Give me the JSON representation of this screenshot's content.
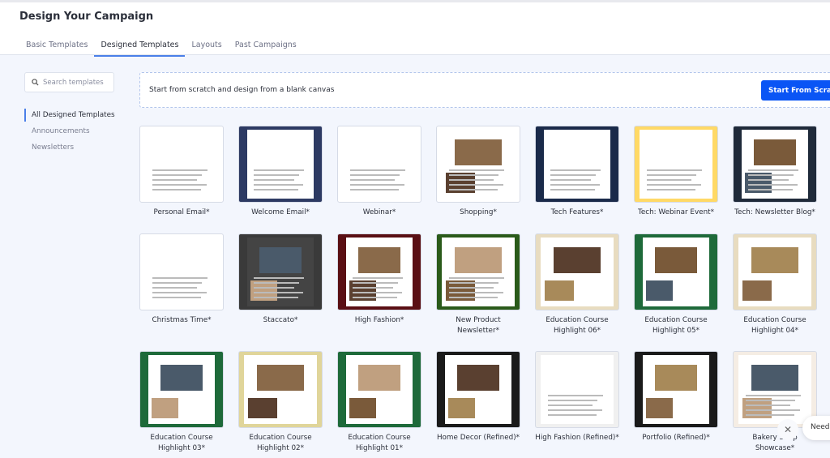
{
  "header": {
    "title": "Design Your Campaign"
  },
  "tabs": [
    {
      "label": "Basic Templates"
    },
    {
      "label": "Designed Templates",
      "active": true
    },
    {
      "label": "Layouts"
    },
    {
      "label": "Past Campaigns"
    }
  ],
  "search": {
    "placeholder": "Search templates"
  },
  "sidebar": {
    "items": [
      {
        "label": "All Designed Templates",
        "active": true
      },
      {
        "label": "Announcements"
      },
      {
        "label": "Newsletters"
      }
    ]
  },
  "blank": {
    "text": "Start from scratch and design from a blank canvas",
    "button": "Start From Scratch"
  },
  "accent": "#0a55f5",
  "templates": [
    {
      "name": "Personal Email*",
      "theme": "#ffffff"
    },
    {
      "name": "Welcome Email*",
      "theme": "#2d3a63"
    },
    {
      "name": "Webinar*",
      "theme": "#ffffff"
    },
    {
      "name": "Shopping*",
      "theme": "#ffffff"
    },
    {
      "name": "Tech Features*",
      "theme": "#1a2a4a"
    },
    {
      "name": "Tech: Webinar Event*",
      "theme": "#ffd966"
    },
    {
      "name": "Tech: Newsletter Blog*",
      "theme": "#1f2a3a"
    },
    {
      "name": "Christmas Time*",
      "theme": "#ffffff"
    },
    {
      "name": "Staccato*",
      "theme": "#3a3a3a"
    },
    {
      "name": "High Fashion*",
      "theme": "#5a0f14"
    },
    {
      "name": "New Product Newsletter*",
      "theme": "#2a5a1a"
    },
    {
      "name": "Education Course Highlight 06*",
      "theme": "#e8dcc0"
    },
    {
      "name": "Education Course Highlight 05*",
      "theme": "#1e6a3a"
    },
    {
      "name": "Education Course Highlight 04*",
      "theme": "#e8dcc0"
    },
    {
      "name": "Education Course Highlight 03*",
      "theme": "#1e6a3a"
    },
    {
      "name": "Education Course Highlight 02*",
      "theme": "#e0d59a"
    },
    {
      "name": "Education Course Highlight 01*",
      "theme": "#1e6a3a"
    },
    {
      "name": "Home Decor (Refined)*",
      "theme": "#1a1a1a"
    },
    {
      "name": "High Fashion (Refined)*",
      "theme": "#f0f0f0"
    },
    {
      "name": "Portfolio (Refined)*",
      "theme": "#1a1a1a"
    },
    {
      "name": "Bakery Shop Showcase*",
      "theme": "#f5ede4"
    }
  ],
  "help": {
    "text": "Need"
  }
}
